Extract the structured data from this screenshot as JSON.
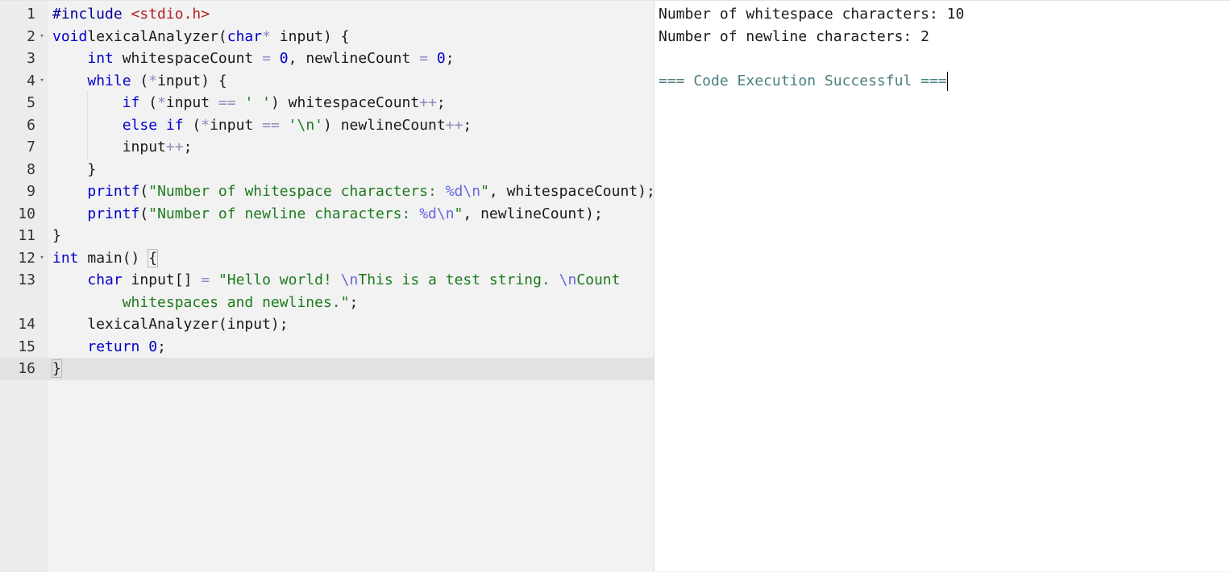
{
  "editor": {
    "lines": [
      {
        "num": "1",
        "fold": false,
        "segs": [
          [
            "pp",
            "#include "
          ],
          [
            "inc",
            "<stdio.h>"
          ]
        ]
      },
      {
        "num": "2",
        "fold": true,
        "segs": [
          [
            "kw",
            "void"
          ],
          [
            "",
            "lexicalAnalyzer("
          ],
          [
            "kw",
            "char"
          ],
          [
            "op",
            "*"
          ],
          [
            "",
            " input) {"
          ]
        ]
      },
      {
        "num": "3",
        "fold": false,
        "segs": [
          [
            "",
            "    "
          ],
          [
            "kw",
            "int"
          ],
          [
            "",
            " whitespaceCount "
          ],
          [
            "op",
            "="
          ],
          [
            "",
            " "
          ],
          [
            "num",
            "0"
          ],
          [
            "",
            ", newlineCount "
          ],
          [
            "op",
            "="
          ],
          [
            "",
            " "
          ],
          [
            "num",
            "0"
          ],
          [
            "",
            ";"
          ]
        ]
      },
      {
        "num": "4",
        "fold": true,
        "segs": [
          [
            "",
            "    "
          ],
          [
            "kw",
            "while"
          ],
          [
            "",
            " ("
          ],
          [
            "op",
            "*"
          ],
          [
            "",
            "input) {"
          ]
        ]
      },
      {
        "num": "5",
        "fold": false,
        "segs": [
          [
            "",
            "        "
          ],
          [
            "kw",
            "if"
          ],
          [
            "",
            " ("
          ],
          [
            "op",
            "*"
          ],
          [
            "",
            "input "
          ],
          [
            "op",
            "=="
          ],
          [
            "",
            " "
          ],
          [
            "str",
            "' '"
          ],
          [
            "",
            ") whitespaceCount"
          ],
          [
            "op",
            "++"
          ],
          [
            "",
            ";"
          ]
        ]
      },
      {
        "num": "6",
        "fold": false,
        "segs": [
          [
            "",
            "        "
          ],
          [
            "kw",
            "else if"
          ],
          [
            "",
            " ("
          ],
          [
            "op",
            "*"
          ],
          [
            "",
            "input "
          ],
          [
            "op",
            "=="
          ],
          [
            "",
            " "
          ],
          [
            "str",
            "'\\n'"
          ],
          [
            "",
            ") newlineCount"
          ],
          [
            "op",
            "++"
          ],
          [
            "",
            ";"
          ]
        ]
      },
      {
        "num": "7",
        "fold": false,
        "segs": [
          [
            "",
            "        input"
          ],
          [
            "op",
            "++"
          ],
          [
            "",
            ";"
          ]
        ]
      },
      {
        "num": "8",
        "fold": false,
        "segs": [
          [
            "",
            "    }"
          ]
        ]
      },
      {
        "num": "9",
        "fold": false,
        "segs": [
          [
            "",
            "    "
          ],
          [
            "kw",
            "printf"
          ],
          [
            "",
            "("
          ],
          [
            "str",
            "\"Number of whitespace characters: "
          ],
          [
            "esc",
            "%d\\n"
          ],
          [
            "str",
            "\""
          ],
          [
            "",
            ", whitespaceCount);"
          ]
        ]
      },
      {
        "num": "10",
        "fold": false,
        "segs": [
          [
            "",
            "    "
          ],
          [
            "kw",
            "printf"
          ],
          [
            "",
            "("
          ],
          [
            "str",
            "\"Number of newline characters: "
          ],
          [
            "esc",
            "%d\\n"
          ],
          [
            "str",
            "\""
          ],
          [
            "",
            ", newlineCount);"
          ]
        ]
      },
      {
        "num": "11",
        "fold": false,
        "segs": [
          [
            "",
            "}"
          ]
        ]
      },
      {
        "num": "12",
        "fold": true,
        "segs": [
          [
            "kw",
            "int"
          ],
          [
            "",
            " main() "
          ],
          [
            "box",
            "{"
          ]
        ]
      },
      {
        "num": "13",
        "fold": false,
        "segs": [
          [
            "",
            "    "
          ],
          [
            "kw",
            "char"
          ],
          [
            "",
            " input[] "
          ],
          [
            "op",
            "="
          ],
          [
            "",
            " "
          ],
          [
            "str",
            "\"Hello world! "
          ],
          [
            "esc",
            "\\n"
          ],
          [
            "str",
            "This is a test string. "
          ],
          [
            "esc",
            "\\n"
          ],
          [
            "str",
            "Count"
          ]
        ]
      },
      {
        "num": "",
        "fold": false,
        "segs": [
          [
            "",
            "        "
          ],
          [
            "str",
            "whitespaces and newlines.\""
          ],
          [
            "",
            ";"
          ]
        ]
      },
      {
        "num": "14",
        "fold": false,
        "segs": [
          [
            "",
            "    lexicalAnalyzer(input);"
          ]
        ]
      },
      {
        "num": "15",
        "fold": false,
        "segs": [
          [
            "",
            "    "
          ],
          [
            "kw",
            "return"
          ],
          [
            "",
            " "
          ],
          [
            "num",
            "0"
          ],
          [
            "",
            ";"
          ]
        ]
      },
      {
        "num": "16",
        "fold": false,
        "active": true,
        "segs": [
          [
            "box",
            "}"
          ]
        ]
      }
    ]
  },
  "output": {
    "lines": [
      "Number of whitespace characters: 10",
      "Number of newline characters: 2",
      "",
      "=== Code Execution Successful ==="
    ]
  },
  "colors": {
    "keyword": "#0000cc",
    "string": "#1d7a1d",
    "include": "#b22222",
    "success": "#4b7f7f"
  }
}
